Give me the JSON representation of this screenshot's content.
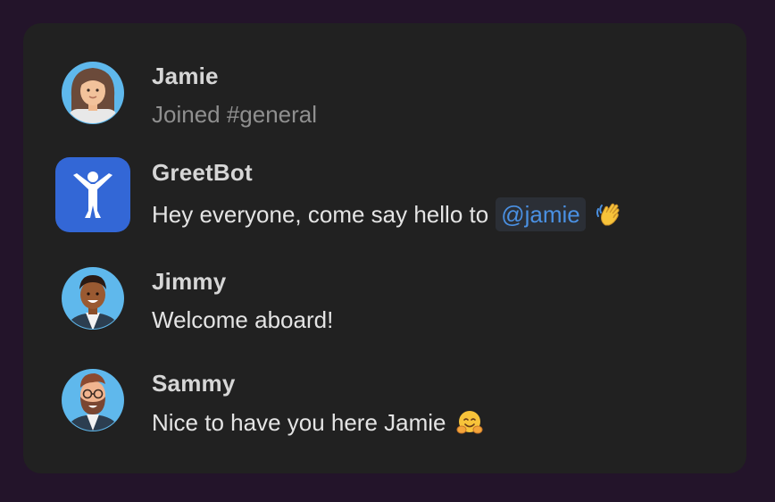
{
  "messages": [
    {
      "name": "Jamie",
      "text": "Joined #general",
      "avatar": "woman-avatar-icon"
    },
    {
      "name": "GreetBot",
      "text": "Hey everyone, come say hello to",
      "mention": "@jamie",
      "emoji": "waving-hand-icon",
      "avatar": "bot-logo-icon"
    },
    {
      "name": "Jimmy",
      "text": "Welcome aboard!",
      "avatar": "man-avatar-icon"
    },
    {
      "name": "Sammy",
      "text": "Nice to have you here Jamie",
      "emoji": "hugging-face-icon",
      "avatar": "bearded-man-avatar-icon"
    }
  ],
  "colors": {
    "page_background": "#23142a",
    "card_background": "#212121",
    "mention_text": "#4a90e2",
    "bot_avatar": "#3367d6"
  }
}
